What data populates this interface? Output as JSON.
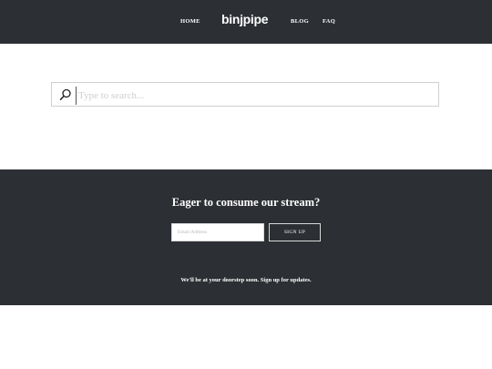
{
  "nav": {
    "home": "HOME",
    "logo": "binjpipe",
    "blog": "BLOG",
    "faq": "FAQ"
  },
  "search": {
    "placeholder": "Type to search...",
    "icon": "search-icon"
  },
  "footer": {
    "heading": "Eager to consume our stream?",
    "email_placeholder": "Email Address",
    "signup_label": "SIGN UP",
    "note": "We'll be at your doorstep soon. Sign up for updates."
  },
  "colors": {
    "dark_bg": "#2c2f33",
    "text_light": "#ffffff",
    "border": "#d0d0d0"
  }
}
